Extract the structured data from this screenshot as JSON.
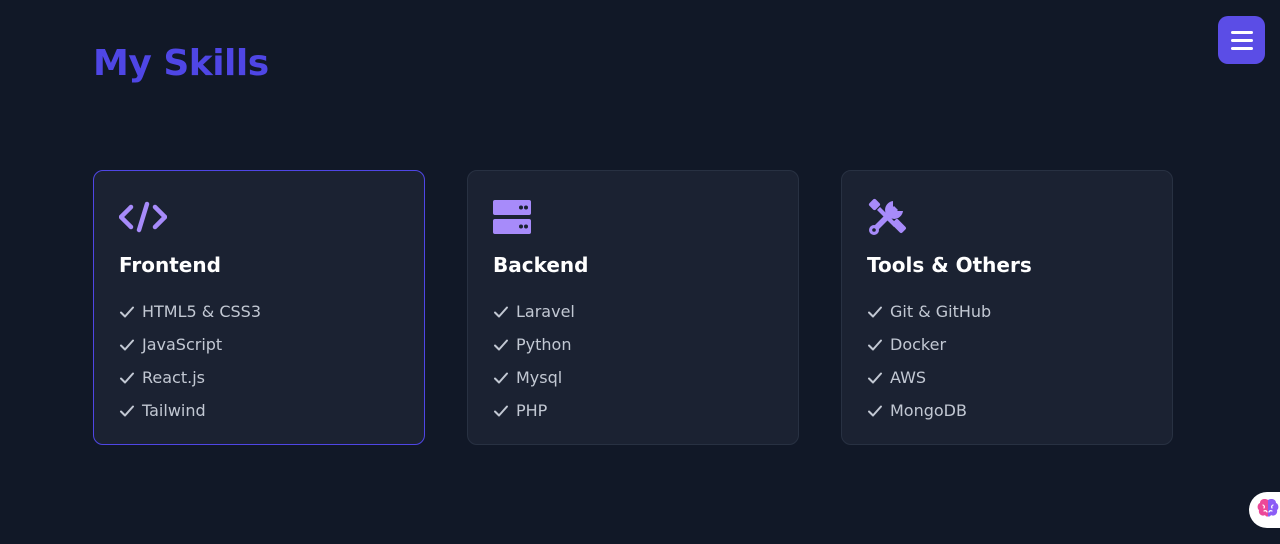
{
  "header": {
    "title": "My Skills"
  },
  "menu_button": {
    "icon": "hamburger-menu-icon"
  },
  "cards": [
    {
      "title": "Frontend",
      "icon": "code-icon",
      "skills": [
        "HTML5 & CSS3",
        "JavaScript",
        "React.js",
        "Tailwind"
      ]
    },
    {
      "title": "Backend",
      "icon": "server-icon",
      "skills": [
        "Laravel",
        "Python",
        "Mysql",
        "PHP"
      ]
    },
    {
      "title": "Tools & Others",
      "icon": "tools-icon",
      "skills": [
        "Git & GitHub",
        "Docker",
        "AWS",
        "MongoDB"
      ]
    }
  ],
  "colors": {
    "background": "#111827",
    "card_background": "#1b2232",
    "accent": "#4f46e5",
    "icon": "#a78bfa",
    "menu_button": "#5b4de6"
  },
  "assistant_button": {
    "icon": "brain-icon"
  }
}
